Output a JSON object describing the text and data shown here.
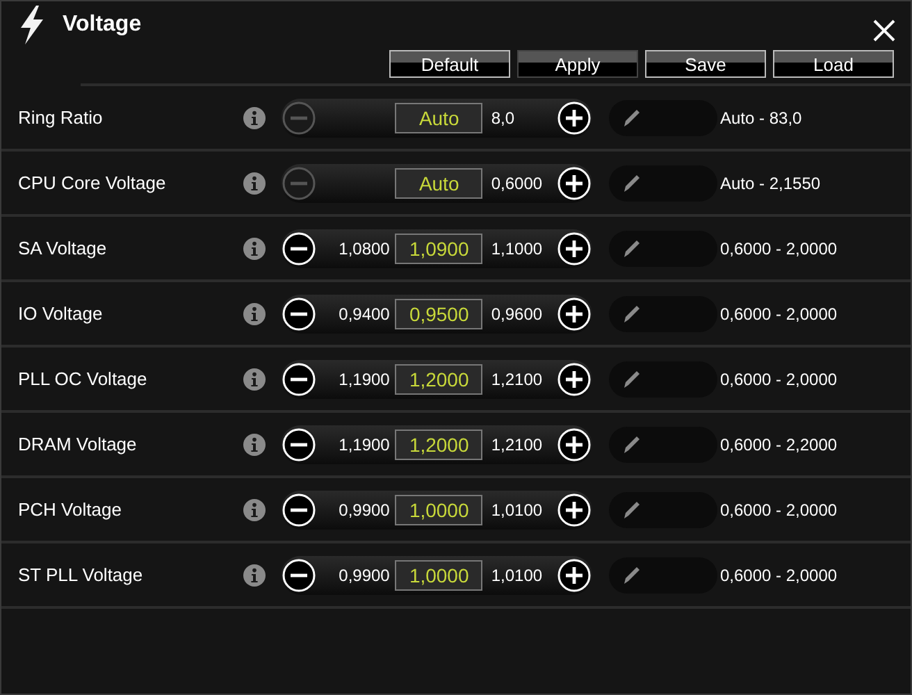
{
  "window": {
    "title": "Voltage"
  },
  "buttons": [
    {
      "label": "Default"
    },
    {
      "label": "Apply"
    },
    {
      "label": "Save"
    },
    {
      "label": "Load"
    }
  ],
  "rows": [
    {
      "label": "Ring Ratio",
      "minus_enabled": false,
      "value": "Auto",
      "upper": "8,0",
      "range": "Auto - 83,0"
    },
    {
      "label": "CPU Core Voltage",
      "minus_enabled": false,
      "value": "Auto",
      "upper": "0,6000",
      "range": "Auto - 2,1550"
    },
    {
      "label": "SA Voltage",
      "minus_enabled": true,
      "lower": "1,0800",
      "value": "1,0900",
      "upper": "1,1000",
      "range": "0,6000 - 2,0000"
    },
    {
      "label": "IO Voltage",
      "minus_enabled": true,
      "lower": "0,9400",
      "value": "0,9500",
      "upper": "0,9600",
      "range": "0,6000 - 2,0000"
    },
    {
      "label": "PLL OC Voltage",
      "minus_enabled": true,
      "lower": "1,1900",
      "value": "1,2000",
      "upper": "1,2100",
      "range": "0,6000 - 2,0000"
    },
    {
      "label": "DRAM Voltage",
      "minus_enabled": true,
      "lower": "1,1900",
      "value": "1,2000",
      "upper": "1,2100",
      "range": "0,6000 - 2,2000"
    },
    {
      "label": "PCH Voltage",
      "minus_enabled": true,
      "lower": "0,9900",
      "value": "1,0000",
      "upper": "1,0100",
      "range": "0,6000 - 2,0000"
    },
    {
      "label": "ST PLL Voltage",
      "minus_enabled": true,
      "lower": "0,9900",
      "value": "1,0000",
      "upper": "1,0100",
      "range": "0,6000 - 2,0000"
    }
  ]
}
